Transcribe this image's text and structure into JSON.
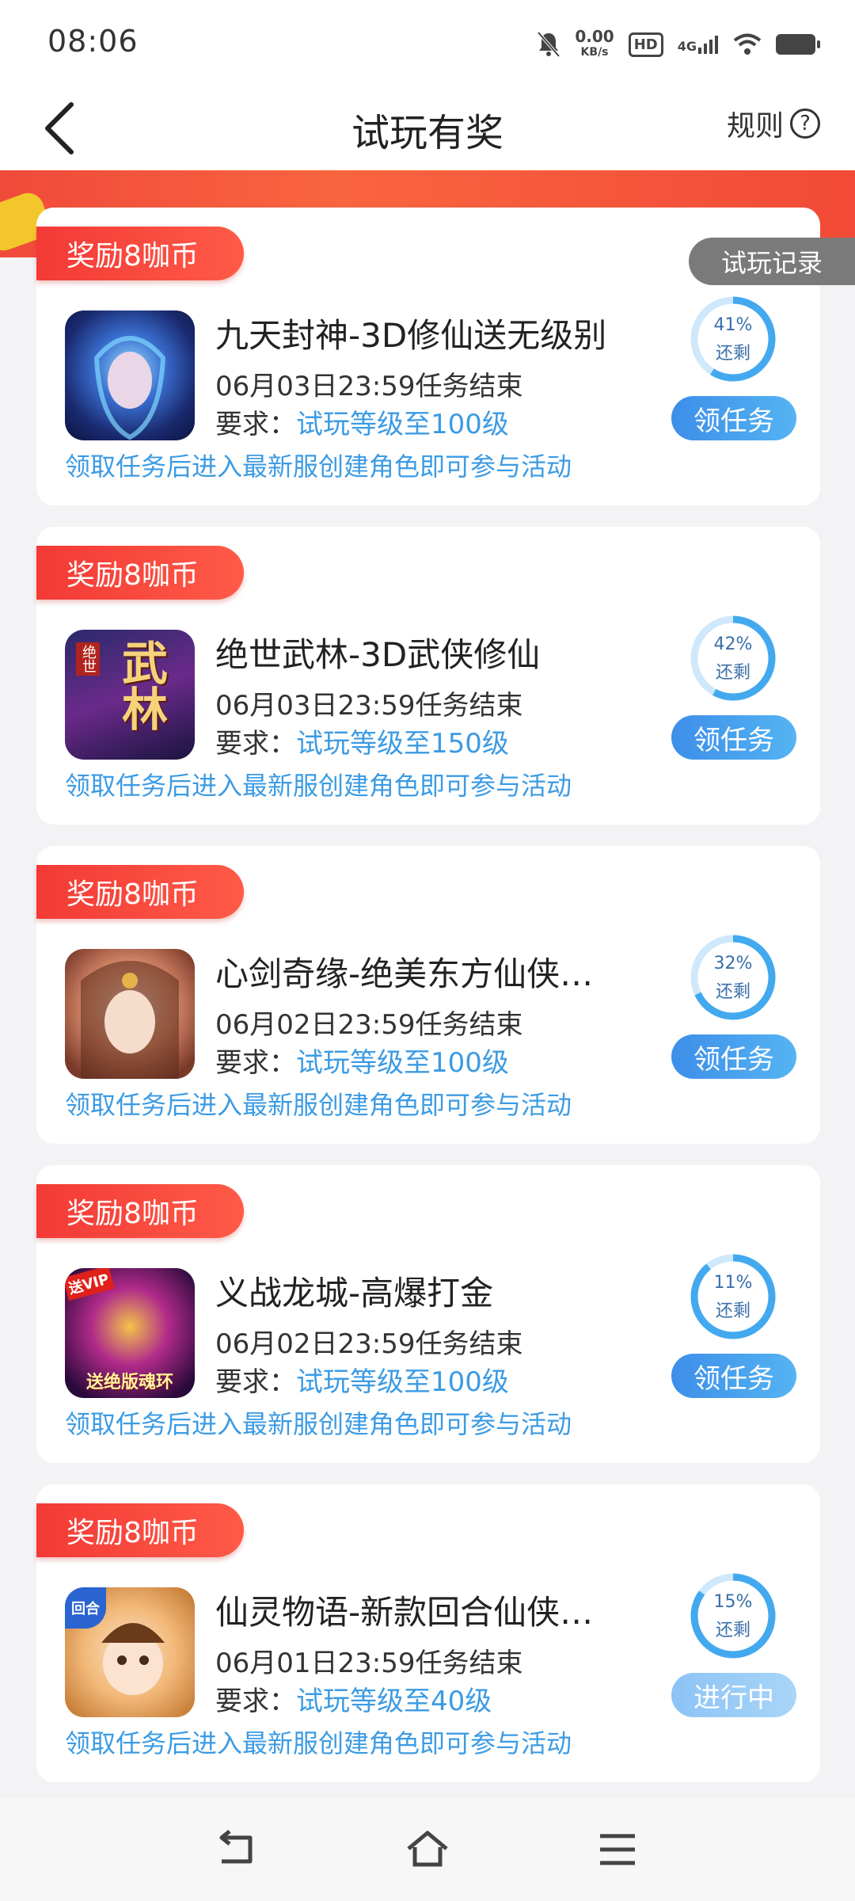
{
  "status": {
    "time": "08:06",
    "speed_top": "0.00",
    "speed_unit": "KB/s",
    "hd": "HD",
    "network": "4G"
  },
  "header": {
    "title": "试玩有奖",
    "rules_label": "规则",
    "rules_icon": "?"
  },
  "record_label": "试玩记录",
  "colors": {
    "accent_blue": "#3c9be3",
    "reward_red": "#f33a36"
  },
  "tasks": [
    {
      "reward": "奖励8咖币",
      "name": "九天封神-3D修仙送无级别",
      "deadline": "06月03日23:59任务结束",
      "req_label": "要求：",
      "req_value": "试玩等级至100级",
      "note": "领取任务后进入最新服创建角色即可参与活动",
      "percent": "41%",
      "remain_label": "还剩",
      "progress": 0.41,
      "button": "领任务",
      "button_state": "available"
    },
    {
      "reward": "奖励8咖币",
      "name": "绝世武林-3D武侠修仙",
      "deadline": "06月03日23:59任务结束",
      "req_label": "要求：",
      "req_value": "试玩等级至150级",
      "note": "领取任务后进入最新服创建角色即可参与活动",
      "percent": "42%",
      "remain_label": "还剩",
      "progress": 0.42,
      "button": "领任务",
      "button_state": "available"
    },
    {
      "reward": "奖励8咖币",
      "name": "心剑奇缘-绝美东方仙侠…",
      "deadline": "06月02日23:59任务结束",
      "req_label": "要求：",
      "req_value": "试玩等级至100级",
      "note": "领取任务后进入最新服创建角色即可参与活动",
      "percent": "32%",
      "remain_label": "还剩",
      "progress": 0.32,
      "button": "领任务",
      "button_state": "available"
    },
    {
      "reward": "奖励8咖币",
      "name": "义战龙城-高爆打金",
      "deadline": "06月02日23:59任务结束",
      "req_label": "要求：",
      "req_value": "试玩等级至100级",
      "note": "领取任务后进入最新服创建角色即可参与活动",
      "percent": "11%",
      "remain_label": "还剩",
      "progress": 0.11,
      "button": "领任务",
      "button_state": "available"
    },
    {
      "reward": "奖励8咖币",
      "name": "仙灵物语-新款回合仙侠…",
      "deadline": "06月01日23:59任务结束",
      "req_label": "要求：",
      "req_value": "试玩等级至40级",
      "note": "领取任务后进入最新服创建角色即可参与活动",
      "percent": "15%",
      "remain_label": "还剩",
      "progress": 0.15,
      "button": "进行中",
      "button_state": "in-progress"
    }
  ],
  "icon_text": {
    "t2a": "绝世",
    "t2b": "武林",
    "t4a": "送VIP",
    "t4b": "送绝版魂环",
    "t5a": "回合"
  }
}
